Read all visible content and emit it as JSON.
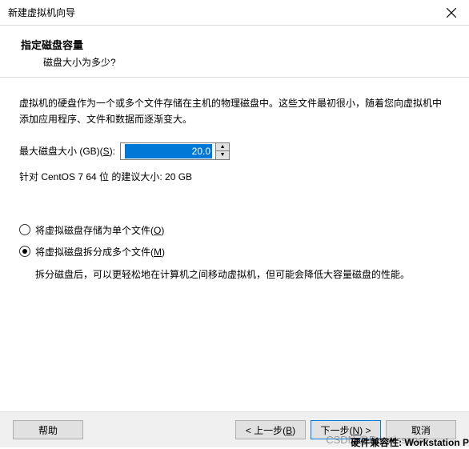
{
  "titlebar": {
    "text": "新建虚拟机向导"
  },
  "header": {
    "title": "指定磁盘容量",
    "sub": "磁盘大小为多少?"
  },
  "content": {
    "desc": "虚拟机的硬盘作为一个或多个文件存储在主机的物理磁盘中。这些文件最初很小，随着您向虚拟机中添加应用程序、文件和数据而逐渐变大。",
    "size_label_pre": "最大磁盘大小 (GB)(",
    "size_label_key": "S",
    "size_label_post": "):",
    "size_value": "20.0",
    "recommend": "针对 CentOS 7 64 位 的建议大小: 20 GB",
    "radio1_pre": "将虚拟磁盘存储为单个文件(",
    "radio1_key": "O",
    "radio1_post": ")",
    "radio2_pre": "将虚拟磁盘拆分成多个文件(",
    "radio2_key": "M",
    "radio2_post": ")",
    "radio2_desc": "拆分磁盘后，可以更轻松地在计算机之间移动虚拟机，但可能会降低大容量磁盘的性能。"
  },
  "footer": {
    "help": "帮助",
    "back_pre": "< 上一步(",
    "back_key": "B",
    "back_post": ")",
    "next_pre": "下一步(",
    "next_key": "N",
    "next_post": ") >",
    "cancel": "取消"
  },
  "watermark": "CSDN @Renaissance",
  "compat": "硬件兼容性:  Workstation P"
}
